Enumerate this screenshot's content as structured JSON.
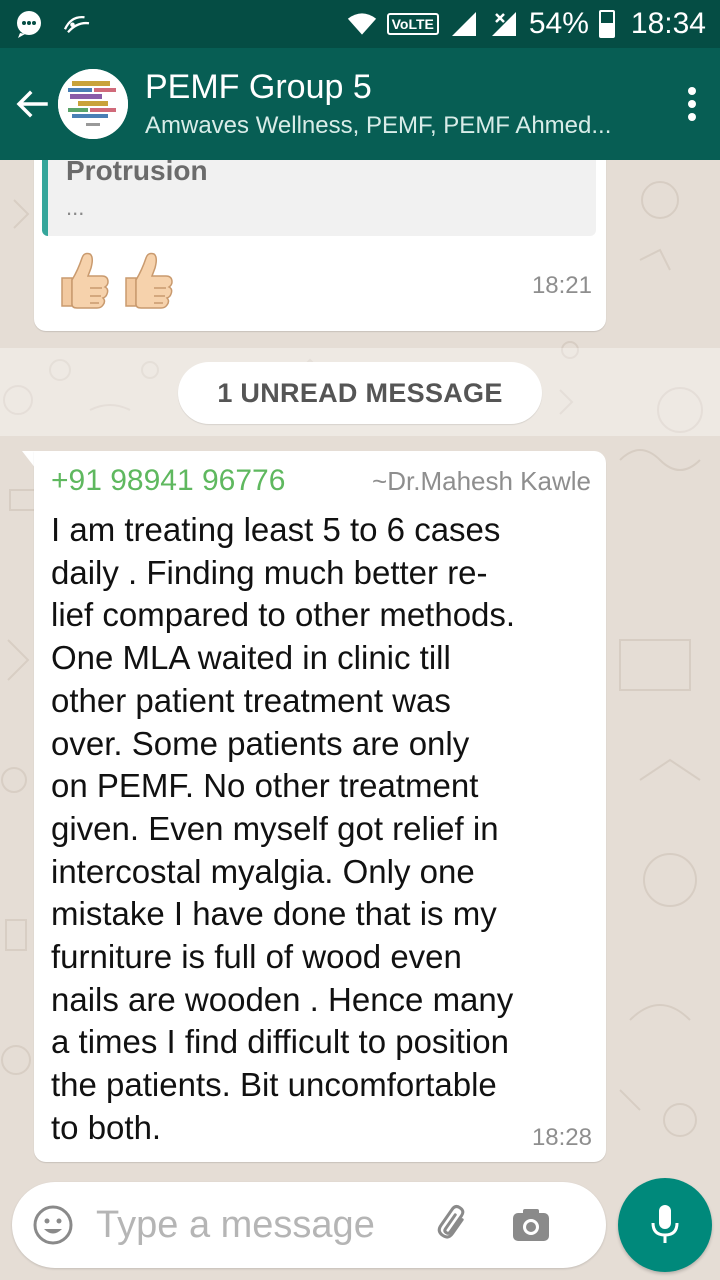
{
  "status_bar": {
    "volte_label": "VoLTE",
    "battery_percent": "54%",
    "battery_level": 0.54,
    "time": "18:34"
  },
  "header": {
    "title": "PEMF Group 5",
    "subtitle": "Amwaves Wellness, PEMF, PEMF Ahmed..."
  },
  "messages": [
    {
      "quoted_title": "Protrusion",
      "quoted_snippet": "...",
      "emojis": [
        "thumbs-up",
        "thumbs-up"
      ],
      "time": "18:21"
    },
    {
      "sender_phone": "+91 98941 96776",
      "sender_name": "~Dr.Mahesh Kawle",
      "text": "I am treating least 5 to 6 cases\ndaily     . Finding much better re-\nlief compared to other methods.\nOne MLA   waited in clinic till\nother patient treatment was\nover.    Some patients are only\non PEMF. No other treatment\ngiven.   Even myself got relief in\nintercostal myalgia.    Only one\nmistake I have done that is my\nfurniture is full of wood even\nnails are wooden . Hence  many\na times I find difficult to position\nthe patients. Bit uncomfortable\nto both.",
      "time": "18:28"
    }
  ],
  "unread_label": "1 UNREAD MESSAGE",
  "composer": {
    "placeholder": "Type a message"
  },
  "colors": {
    "status_bar": "#054d44",
    "app_bar": "#075e54",
    "chat_background": "#e5ddd5",
    "sender_phone": "#5fb85f",
    "quote_border": "#35a69b",
    "mic_button": "#00897b"
  }
}
